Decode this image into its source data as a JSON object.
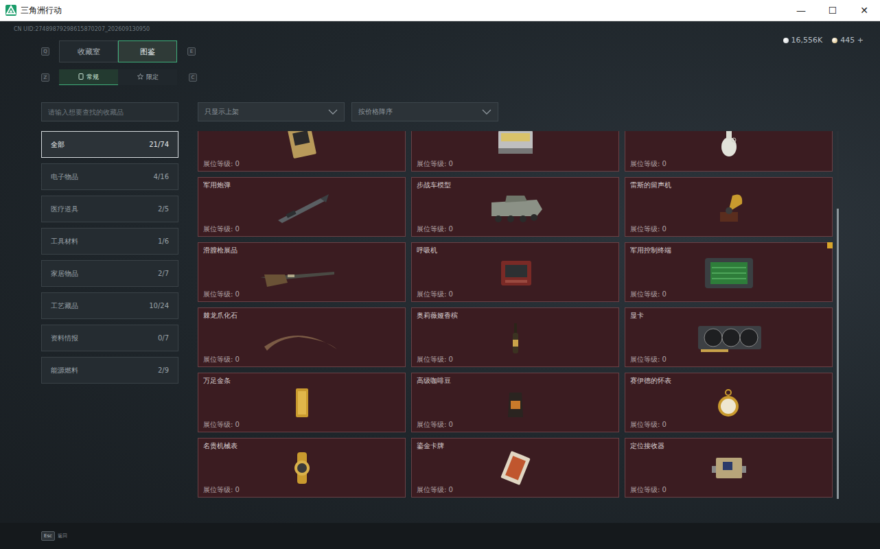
{
  "window": {
    "title": "三角洲行动",
    "controls": [
      "—",
      "☐",
      "✕"
    ]
  },
  "uid": "CN UID:27489879298615870207_202609130950",
  "currency": [
    {
      "value": "16,556K",
      "color": "#c9ced2"
    },
    {
      "value": "445 +",
      "color": "#d8b56a"
    }
  ],
  "main_tabs": {
    "prev_key": "Q",
    "next_key": "E",
    "items": [
      {
        "label": "收藏室",
        "selected": false
      },
      {
        "label": "图鉴",
        "selected": true
      }
    ]
  },
  "sub_tabs": {
    "prev_key": "Z",
    "next_key": "C",
    "items": [
      {
        "label": "常规",
        "selected": true
      },
      {
        "label": "限定",
        "selected": false
      }
    ]
  },
  "search": {
    "placeholder": "请输入想要查找的收藏品"
  },
  "filters": [
    {
      "label": "只显示上架"
    },
    {
      "label": "按价格降序"
    }
  ],
  "categories": [
    {
      "label": "全部",
      "count": "21/74",
      "selected": true
    },
    {
      "label": "电子物品",
      "count": "4/16",
      "selected": false
    },
    {
      "label": "医疗道具",
      "count": "2/5",
      "selected": false
    },
    {
      "label": "工具材料",
      "count": "1/6",
      "selected": false
    },
    {
      "label": "家居物品",
      "count": "2/7",
      "selected": false
    },
    {
      "label": "工艺藏品",
      "count": "10/24",
      "selected": false
    },
    {
      "label": "资料情报",
      "count": "0/7",
      "selected": false
    },
    {
      "label": "能源燃料",
      "count": "2/9",
      "selected": false
    }
  ],
  "items": [
    {
      "level": "展位等级: 0",
      "flag": false
    },
    {
      "level": "展位等级: 0",
      "flag": false
    },
    {
      "level": "展位等级: 0",
      "flag": false
    },
    {
      "name": "军用炮弹",
      "level": "展位等级: 0",
      "flag": false
    },
    {
      "name": "步战车模型",
      "level": "展位等级: 0",
      "flag": false
    },
    {
      "name": "雷斯的留声机",
      "level": "展位等级: 0",
      "flag": false
    },
    {
      "name": "滑膛枪展品",
      "level": "展位等级: 0",
      "flag": false
    },
    {
      "name": "呼吸机",
      "level": "展位等级: 0",
      "flag": false
    },
    {
      "name": "军用控制终端",
      "level": "展位等级: 0",
      "flag": true
    },
    {
      "name": "棘龙爪化石",
      "level": "展位等级: 0",
      "flag": false
    },
    {
      "name": "奥莉薇娅香槟",
      "level": "展位等级: 0",
      "flag": false
    },
    {
      "name": "显卡",
      "level": "展位等级: 0",
      "flag": false
    },
    {
      "name": "万足金条",
      "level": "展位等级: 0",
      "flag": false
    },
    {
      "name": "高级咖啡豆",
      "level": "展位等级: 0",
      "flag": false
    },
    {
      "name": "赛伊德的怀表",
      "level": "展位等级: 0",
      "flag": false
    },
    {
      "name": "名贵机械表",
      "level": "展位等级: 0",
      "flag": false
    },
    {
      "name": "鎏金卡牌",
      "level": "展位等级: 0",
      "flag": false
    },
    {
      "name": "定位接收器",
      "level": "展位等级: 0",
      "flag": false
    }
  ],
  "scrollbar": {
    "level": 0.79
  },
  "footer": {
    "key": "Esc",
    "label": "返回"
  }
}
